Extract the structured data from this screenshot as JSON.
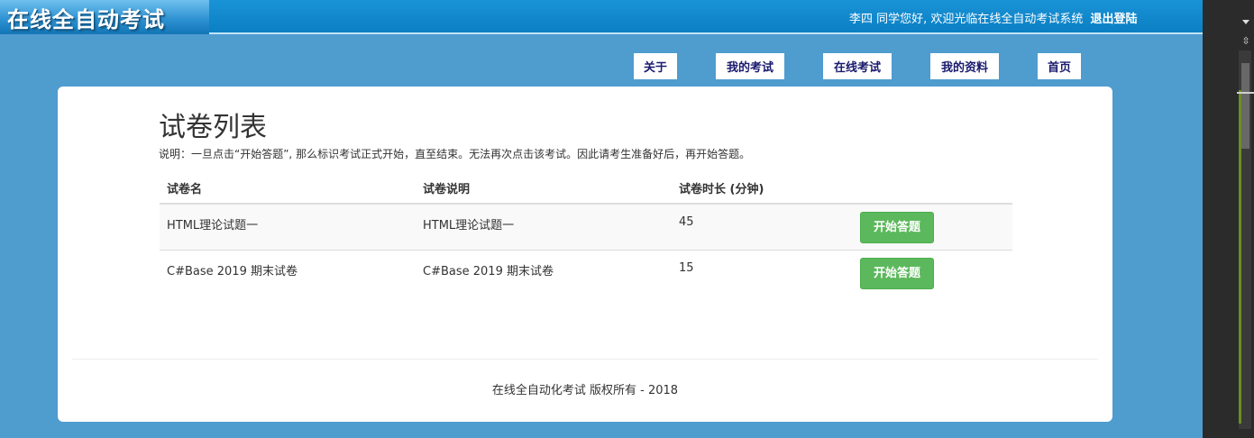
{
  "header": {
    "logo": "在线全自动考试",
    "welcome": "李四 同学您好, 欢迎光临在线全自动考试系统",
    "logout": "退出登陆"
  },
  "nav": [
    {
      "label": "关于"
    },
    {
      "label": "我的考试"
    },
    {
      "label": "在线考试"
    },
    {
      "label": "我的资料"
    },
    {
      "label": "首页"
    }
  ],
  "main": {
    "title": "试卷列表",
    "note": "说明：一旦点击“开始答题”, 那么标识考试正式开始，直至结束。无法再次点击该考试。因此请考生准备好后，再开始答题。",
    "columns": [
      "试卷名",
      "试卷说明",
      "试卷时长 (分钟)",
      ""
    ],
    "rows": [
      {
        "name": "HTML理论试题一",
        "desc": "HTML理论试题一",
        "duration": "45",
        "action": "开始答题"
      },
      {
        "name": "C#Base 2019 期末试卷",
        "desc": "C#Base 2019 期末试卷",
        "duration": "15",
        "action": "开始答题"
      }
    ]
  },
  "footer": {
    "text": "在线全自动化考试 版权所有 - 2018"
  },
  "colors": {
    "background": "#4f9ccf",
    "header": "#0b7fc4",
    "start_button": "#5cb85c",
    "nav_text": "#1a1a6e"
  }
}
